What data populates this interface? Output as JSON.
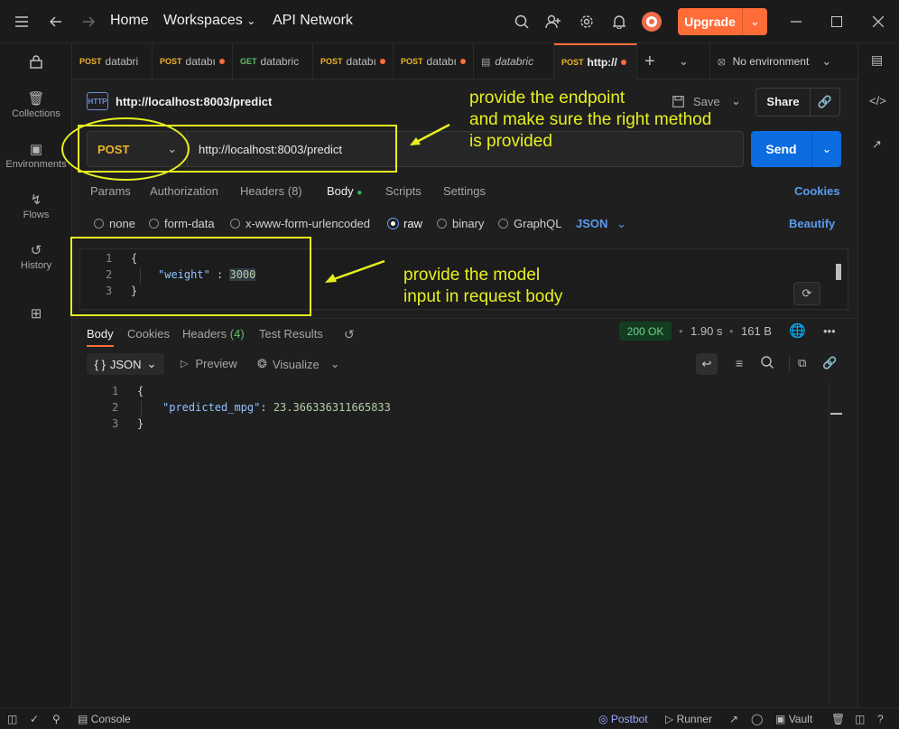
{
  "titlebar": {
    "nav_home": "Home",
    "nav_workspaces": "Workspaces",
    "nav_api_network": "API Network",
    "upgrade_label": "Upgrade"
  },
  "sidebar": {
    "items": [
      {
        "label": "Collections"
      },
      {
        "label": "Environments"
      },
      {
        "label": "Flows"
      },
      {
        "label": "History"
      }
    ]
  },
  "tabs": [
    {
      "method": "POST",
      "name": "databri"
    },
    {
      "method": "POST",
      "name": "databı"
    },
    {
      "method": "GET",
      "name": "databric"
    },
    {
      "method": "POST",
      "name": "databı"
    },
    {
      "method": "POST",
      "name": "databı"
    },
    {
      "method": "",
      "name": "databric"
    },
    {
      "method": "POST",
      "name": "http://"
    }
  ],
  "environment": "No environment",
  "request": {
    "title": "http://localhost:8003/predict",
    "method": "POST",
    "url": "http://localhost:8003/predict",
    "save_label": "Save",
    "share_label": "Share",
    "send_label": "Send"
  },
  "request_tabs": {
    "params": "Params",
    "authorization": "Authorization",
    "headers": "Headers (8)",
    "body": "Body",
    "scripts": "Scripts",
    "settings": "Settings",
    "cookies": "Cookies"
  },
  "body_types": {
    "none": "none",
    "form_data": "form-data",
    "urlencoded": "x-www-form-urlencoded",
    "raw": "raw",
    "binary": "binary",
    "graphql": "GraphQL",
    "json": "JSON",
    "beautify": "Beautify"
  },
  "request_body": {
    "line1": "{",
    "key": "\"weight\"",
    "sep": " : ",
    "value": "3000",
    "line3": "}",
    "n1": "1",
    "n2": "2",
    "n3": "3"
  },
  "response_tabs": {
    "body": "Body",
    "cookies": "Cookies",
    "headers_label": "Headers",
    "headers_count": "(4)",
    "test_results": "Test Results"
  },
  "response_meta": {
    "status": "200 OK",
    "time": "1.90 s",
    "size": "161 B"
  },
  "response_view": {
    "format": "JSON",
    "preview": "Preview",
    "visualize": "Visualize"
  },
  "response_body": {
    "line1": "{",
    "key": "\"predicted_mpg\"",
    "sep": ": ",
    "value": "23.366336311665833",
    "line3": "}",
    "n1": "1",
    "n2": "2",
    "n3": "3"
  },
  "statusbar": {
    "console": "Console",
    "postbot": "Postbot",
    "runner": "Runner",
    "vault": "Vault"
  },
  "annotations": {
    "endpoint": [
      "provide the endpoint",
      "and make sure the right method",
      "is provided"
    ],
    "body": [
      "provide the model",
      "input in request body"
    ]
  },
  "colors": {
    "accent": "#ff6c37",
    "send": "#0c6ce0",
    "annotation": "#e6f020",
    "method_post": "#f0b429",
    "method_get": "#5fbf6b",
    "status_ok": "#6fd08c"
  }
}
